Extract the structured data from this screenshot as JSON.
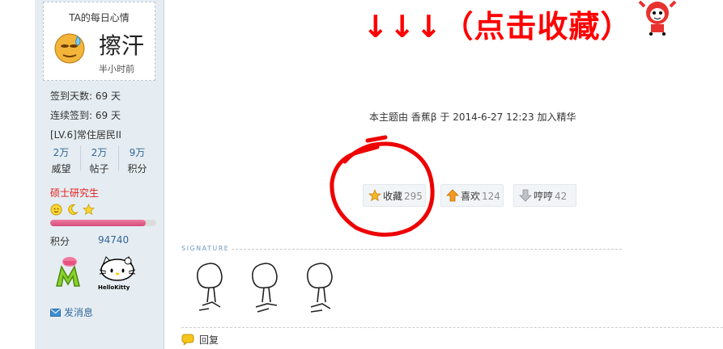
{
  "sidebar": {
    "mood": {
      "title": "TA的每日心情",
      "text": "擦汗",
      "time": "半小时前",
      "icon": "sweat-face-icon"
    },
    "signin_days": "签到天数: 69 天",
    "consecutive_signin": "连续签到: 69 天",
    "level": "[LV.6]常住居民II",
    "stats": [
      {
        "value": "2万",
        "label": "威望"
      },
      {
        "value": "2万",
        "label": "帖子"
      },
      {
        "value": "9万",
        "label": "积分"
      }
    ],
    "rank_title": "硕士研究生",
    "badge_icons": [
      "sun-icon",
      "moon-icon",
      "star-icon"
    ],
    "progress_fraction": 0.9,
    "points_label": "积分",
    "points_value": "94740",
    "medals": [
      "m-medal-icon",
      "hello-kitty-medal-icon"
    ],
    "send_message": "发消息"
  },
  "main": {
    "banner_text": "↓↓↓（点击收藏）",
    "meta": {
      "prefix": "本主题由",
      "user": "香蕉β",
      "mid": "于",
      "date": "2014-6-27 12:23",
      "suffix": "加入精华"
    },
    "actions": [
      {
        "label": "收藏",
        "count": "295",
        "icon": "star-icon"
      },
      {
        "label": "喜欢",
        "count": "124",
        "icon": "arrow-up-icon"
      },
      {
        "label": "哼哼",
        "count": "42",
        "icon": "arrow-down-icon"
      }
    ],
    "signature_label": "SIGNATURE",
    "reply_label": "回复"
  },
  "colors": {
    "accent_red": "#ff0000",
    "link_blue": "#336699",
    "sidebar_bg": "#e5edf2"
  }
}
